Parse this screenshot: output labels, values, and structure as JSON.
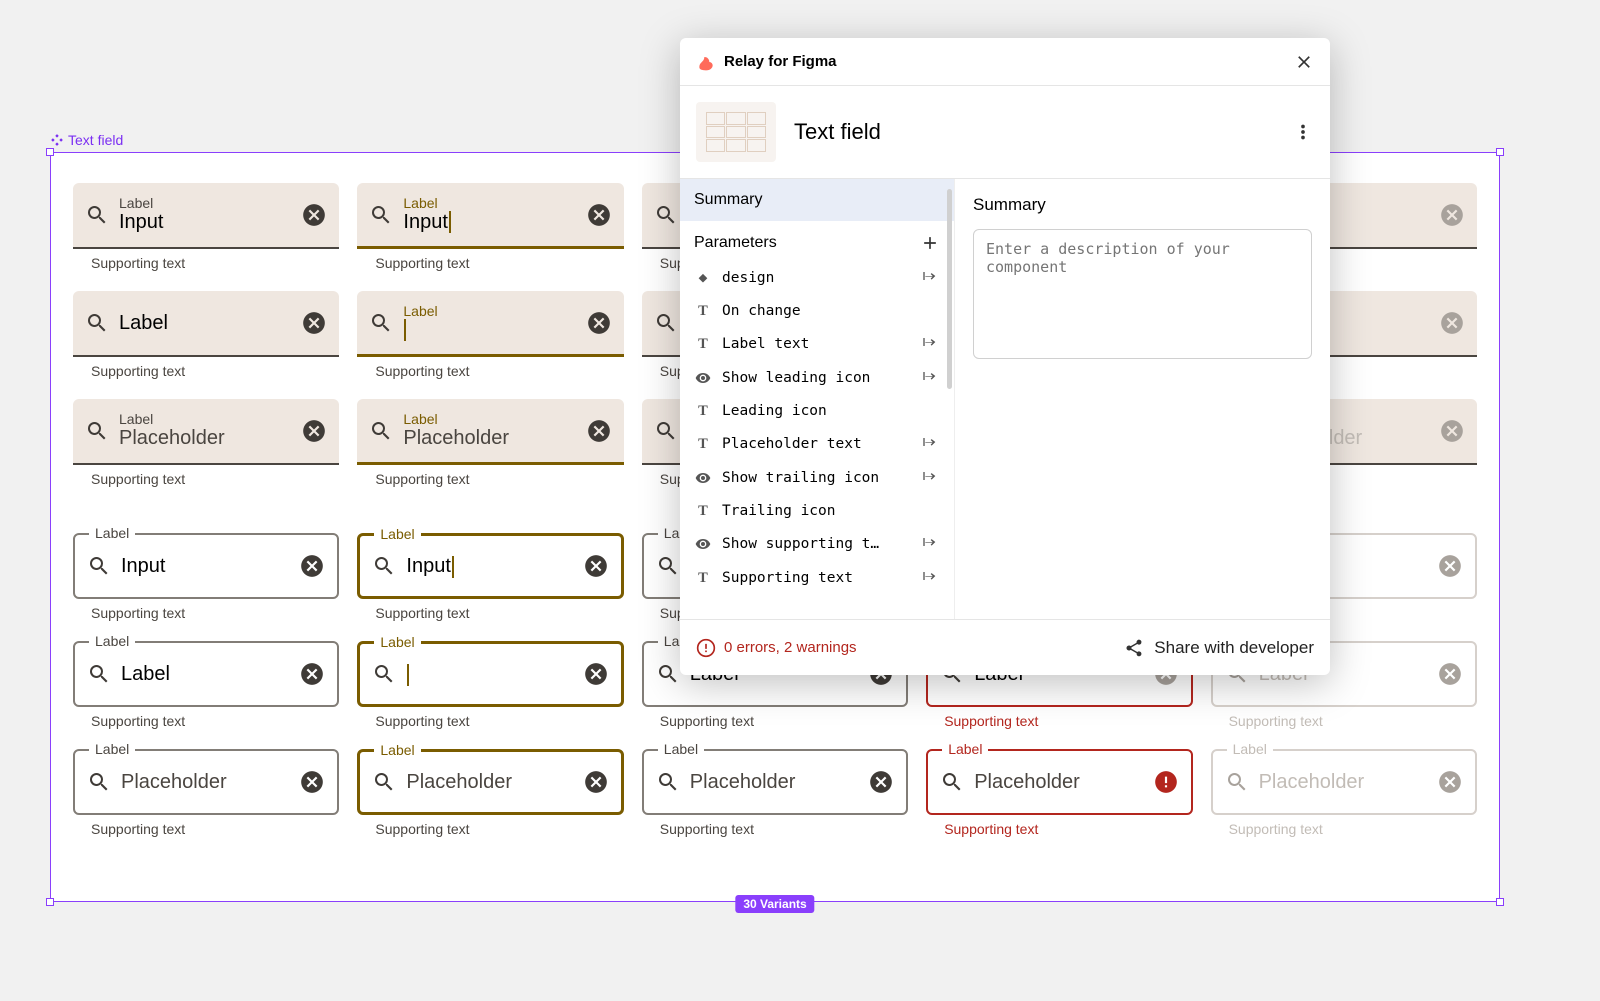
{
  "frame": {
    "name": "Text field",
    "variants_badge": "30 Variants"
  },
  "textfield": {
    "label": "Label",
    "input": "Input",
    "placeholder": "Placeholder",
    "supporting": "Supporting text"
  },
  "panel": {
    "app_title": "Relay for Figma",
    "component_name": "Text field",
    "left": {
      "summary": "Summary",
      "parameters_heading": "Parameters",
      "params": [
        {
          "icon": "diamond",
          "name": "design",
          "action": true
        },
        {
          "icon": "T",
          "name": "On change",
          "action": false
        },
        {
          "icon": "T",
          "name": "Label text",
          "action": true
        },
        {
          "icon": "eye",
          "name": "Show leading icon",
          "action": true
        },
        {
          "icon": "T",
          "name": "Leading icon",
          "action": false
        },
        {
          "icon": "T",
          "name": "Placeholder text",
          "action": true
        },
        {
          "icon": "eye",
          "name": "Show trailing icon",
          "action": true
        },
        {
          "icon": "T",
          "name": "Trailing icon",
          "action": false
        },
        {
          "icon": "eye",
          "name": "Show supporting t…",
          "action": true
        },
        {
          "icon": "T",
          "name": "Supporting text",
          "action": true
        }
      ]
    },
    "right": {
      "heading": "Summary",
      "desc_placeholder": "Enter a description of your component"
    },
    "footer": {
      "warnings": "0 errors, 2 warnings",
      "share": "Share with developer"
    }
  }
}
